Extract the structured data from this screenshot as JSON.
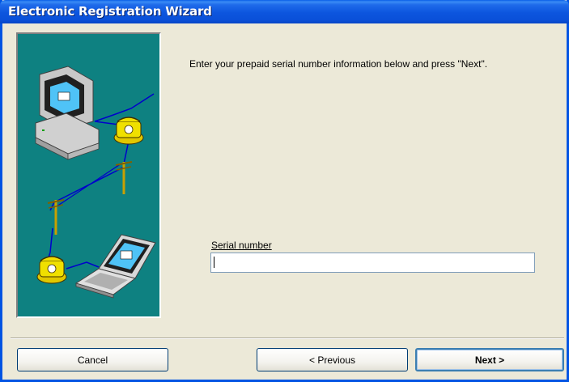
{
  "window": {
    "title": "Electronic Registration Wizard"
  },
  "main": {
    "instructions": "Enter your prepaid serial number information below and press \"Next\".",
    "serial_label": "Serial number",
    "serial_value": ""
  },
  "buttons": {
    "cancel": "Cancel",
    "previous": "< Previous",
    "next": "Next >"
  },
  "colors": {
    "titlebar": "#0A50D8",
    "illustration_bg": "#0E8181",
    "dialog_bg": "#ECE9D8"
  },
  "icons": {
    "illustration": "computer-phone-telephone-pole-laptop-illustration"
  }
}
